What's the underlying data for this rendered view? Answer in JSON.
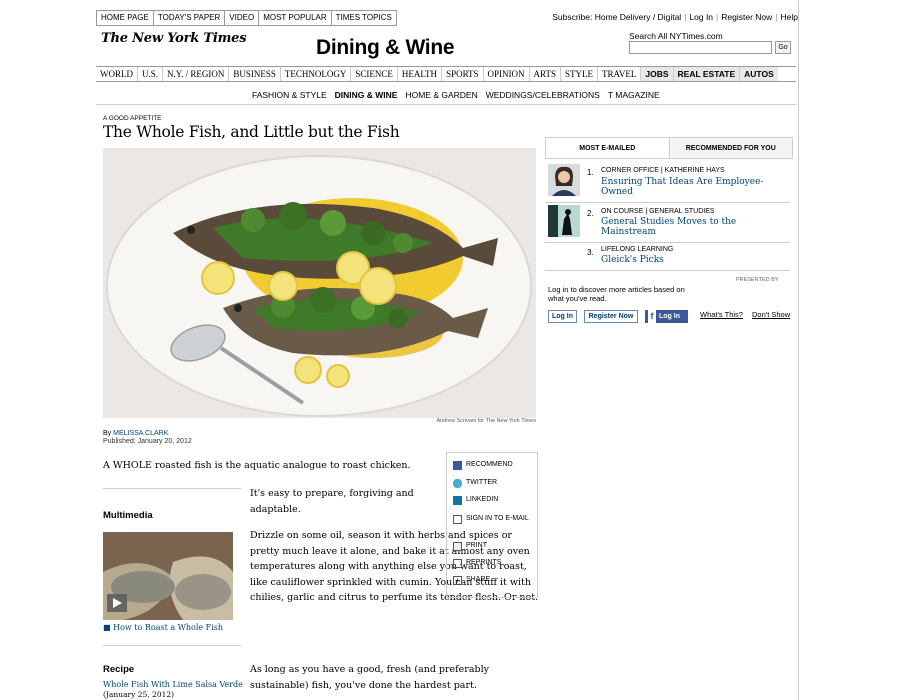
{
  "top_nav": [
    "HOME PAGE",
    "TODAY'S PAPER",
    "VIDEO",
    "MOST POPULAR",
    "TIMES TOPICS"
  ],
  "account_links": {
    "subscribe": "Subscribe: Home Delivery / Digital",
    "login": "Log In",
    "register": "Register Now",
    "help": "Help"
  },
  "logo": "The New York Times",
  "section": "Dining & Wine",
  "search": {
    "label": "Search All NYTimes.com",
    "button": "Go",
    "value": ""
  },
  "main_nav": [
    "WORLD",
    "U.S.",
    "N.Y. / REGION",
    "BUSINESS",
    "TECHNOLOGY",
    "SCIENCE",
    "HEALTH",
    "SPORTS",
    "OPINION",
    "ARTS",
    "STYLE",
    "TRAVEL",
    "JOBS",
    "REAL ESTATE",
    "AUTOS"
  ],
  "sub_nav": [
    "FASHION & STYLE",
    "DINING & WINE",
    "HOME & GARDEN",
    "WEDDINGS/CELEBRATIONS",
    "T MAGAZINE"
  ],
  "article": {
    "kicker": "A GOOD APPETITE",
    "headline": "The Whole Fish, and Little but the Fish",
    "photo_credit": "Andrew Scrivani for The New York Times",
    "byline_prefix": "By",
    "author": "MELISSA CLARK",
    "published": "Published: January 20, 2012",
    "paragraphs": [
      "A WHOLE roasted fish is the aquatic analogue to roast chicken.",
      "It's easy to prepare, forgiving and adaptable.",
      "Drizzle on some oil, season it with herbs and spices or pretty much leave it alone, and bake it at almost any oven temperatures along with anything else you want to roast, like cauliflower sprinkled with cumin. You can stuff it with chilies, garlic and citrus to perfume its tender flesh. Or not.",
      "As long as you have a good, fresh (and preferably sustainable) fish, you've done the hardest part."
    ]
  },
  "sidebar": {
    "multimedia_heading": "Multimedia",
    "multimedia_caption": "How to Roast a Whole Fish",
    "recipe_heading": "Recipe",
    "recipe_link": "Whole Fish With Lime Salsa Verde",
    "recipe_date": "(January 25, 2012)"
  },
  "share_tools": [
    "RECOMMEND",
    "TWITTER",
    "LINKEDIN",
    "SIGN IN TO E-MAIL",
    "PRINT",
    "REPRINTS",
    "SHARE"
  ],
  "popular": {
    "tabs": [
      "MOST E-MAILED",
      "RECOMMENDED FOR YOU"
    ],
    "items": [
      {
        "num": "1.",
        "kicker": "CORNER OFFICE | KATHERINE HAYS",
        "title": "Ensuring That Ideas Are Employee-Owned"
      },
      {
        "num": "2.",
        "kicker": "ON COURSE | GENERAL STUDIES",
        "title": "General Studies Moves to the Mainstream"
      },
      {
        "num": "3.",
        "kicker": "LIFELONG LEARNING",
        "title": "Gleick's Picks"
      }
    ],
    "presented_by": "PRESENTED BY",
    "login_text": "Log in to discover more articles based on what you've read.",
    "login_button": "Log In",
    "register_button": "Register Now",
    "fb_button": "Log In",
    "whats_this": "What's This?",
    "dont_show": "Don't Show"
  },
  "colors": {
    "link": "#004276",
    "facebook": "#3b5998",
    "rule": "#cccccc"
  }
}
